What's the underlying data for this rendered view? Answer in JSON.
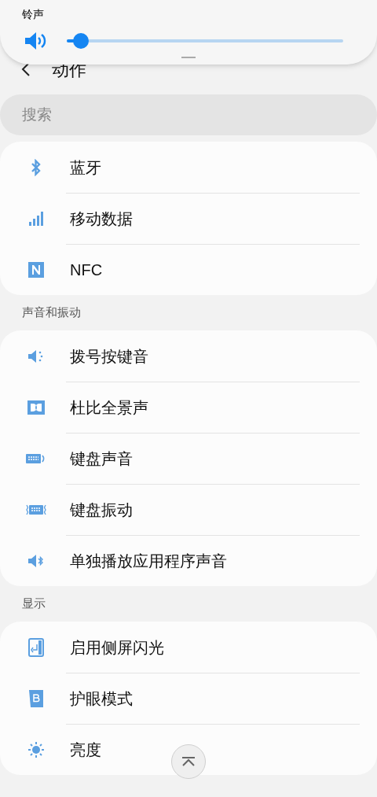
{
  "volume_panel": {
    "label": "铃声",
    "level": 0.05
  },
  "header": {
    "title": "动作"
  },
  "search": {
    "placeholder": "搜索"
  },
  "sections": [
    {
      "items": [
        {
          "label": "蓝牙"
        },
        {
          "label": "移动数据"
        },
        {
          "label": "NFC"
        }
      ]
    },
    {
      "title": "声音和振动",
      "items": [
        {
          "label": "拨号按键音"
        },
        {
          "label": "杜比全景声"
        },
        {
          "label": "键盘声音"
        },
        {
          "label": "键盘振动"
        },
        {
          "label": "单独播放应用程序声音"
        }
      ]
    },
    {
      "title": "显示",
      "items": [
        {
          "label": "启用侧屏闪光"
        },
        {
          "label": "护眼模式"
        },
        {
          "label": "亮度"
        }
      ]
    }
  ]
}
